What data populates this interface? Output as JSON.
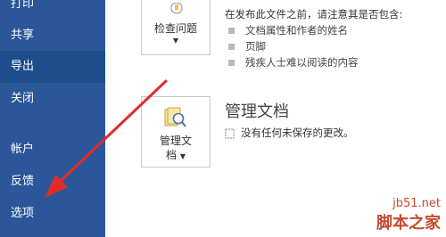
{
  "sidebar": {
    "items": [
      {
        "label": "打印"
      },
      {
        "label": "共享"
      },
      {
        "label": "导出"
      },
      {
        "label": "关闭"
      },
      {
        "label": "帐户"
      },
      {
        "label": "反馈"
      },
      {
        "label": "选项"
      }
    ],
    "active_index": 2,
    "colors": {
      "background": "#2b579a",
      "active": "#1e4e8c"
    }
  },
  "inspect": {
    "button_label": "检查问题",
    "description": "在发布此文件之前，请注意其是否包含:",
    "bullets": [
      "文档属性和作者的姓名",
      "页脚",
      "残疾人士难以阅读的内容"
    ]
  },
  "manage": {
    "title": "管理文档",
    "button_label_line1": "管理文",
    "button_label_line2": "档",
    "status_text": "没有任何未保存的更改。",
    "icon": "document-magnifier-icon"
  },
  "annotation": {
    "arrow_color": "#e02b2b"
  },
  "watermark": {
    "line1": "jb51.net",
    "line2": "脚本之家"
  }
}
